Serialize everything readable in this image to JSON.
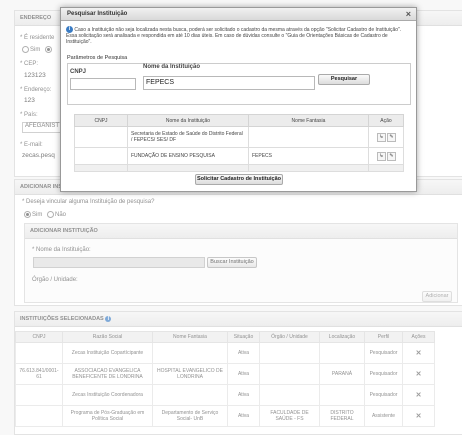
{
  "endereco": {
    "header": "ENDEREÇO",
    "residente_label": "* É residente",
    "sim": "Sim",
    "cep_label": "* CEP:",
    "cep_value": "123123",
    "endereco_label": "* Endereço:",
    "endereco_value": "123",
    "pais_label": "* País:",
    "pais_value": "AFEGANIST",
    "email_label": "* E-mail:",
    "email_value": "zecas.pesq"
  },
  "adicionar_inst": {
    "header": "ADICIONAR INST",
    "question": "* Deseja vincular alguma Instituição de pesquisa?",
    "sim": "Sim",
    "nao": "Não",
    "sub_header": "ADICIONAR INSTITUIÇÃO",
    "nome_label": "* Nome da Instituição:",
    "buscar_btn": "Buscar Instituição",
    "orgao_label": "Órgão / Unidade:",
    "adicionar_btn": "Adicionar"
  },
  "selecionadas": {
    "header": "INSTITUIÇÕES SELECIONADAS",
    "columns": [
      "CNPJ",
      "Razão Social",
      "Nome Fantasia",
      "Situação",
      "Órgão / Unidade",
      "Localização",
      "Perfil",
      "Ações"
    ],
    "rows": [
      {
        "cnpj": "",
        "razao": "Zecas Instituição Copartícipante",
        "fantasia": "",
        "situacao": "Ativa",
        "orgao": "",
        "local": "",
        "perfil": "Pesquisador"
      },
      {
        "cnpj": "76.613.841/0001-61",
        "razao": "ASSOCIACAO EVANGELICA BENEFICENTE DE LONDRINA",
        "fantasia": "HOSPITAL EVANGELICO DE LONDRINA",
        "situacao": "Ativa",
        "orgao": "",
        "local": "PARANÁ",
        "perfil": "Pesquisador"
      },
      {
        "cnpj": "",
        "razao": "Zecas Instituição Coordenadora",
        "fantasia": "",
        "situacao": "Ativa",
        "orgao": "",
        "local": "",
        "perfil": "Pesquisador"
      },
      {
        "cnpj": "",
        "razao": "Programa de Pós-Graduação em Política Social",
        "fantasia": "Departamento de Serviço Social- UnB",
        "situacao": "Ativa",
        "orgao": "FACULDADE DE SAÚDE - FS",
        "local": "DISTRITO FEDERAL",
        "perfil": "Assistente"
      }
    ]
  },
  "modal": {
    "title": "Pesquisar Instituição",
    "info": "Caso a Instituição não seja localizada nesta busca, poderá ser solicitado o cadastro da mesma através da opção \"Solicitar Cadastro de Instituição\". Essa solicitação será analisada e respondida em até 10 dias úteis. Em caso de dúvidas consulte o \"Guia de Orientações Básicas de Cadastro de Instituição\".",
    "params_label": "Parâmetros de Pesquisa",
    "cnpj_label": "CNPJ",
    "cnpj_value": "",
    "nome_label": "Nome da Instituição",
    "nome_value": "FEPECS",
    "pesquisar_btn": "Pesquisar",
    "columns": [
      "CNPJ",
      "Nome da Instituição",
      "Nome Fantasia",
      "Ação"
    ],
    "results": [
      {
        "cnpj": "",
        "nome": "Secretaria de Estado de Saúde do Distrito Federal / FEPECS/ SES/ DF",
        "fantasia": ""
      },
      {
        "cnpj": "",
        "nome": "FUNDAÇÃO DE ENSINO PESQUISA",
        "fantasia": "FEPECS"
      }
    ],
    "solicitar_btn": "Solicitar Cadastro de Instituição"
  }
}
